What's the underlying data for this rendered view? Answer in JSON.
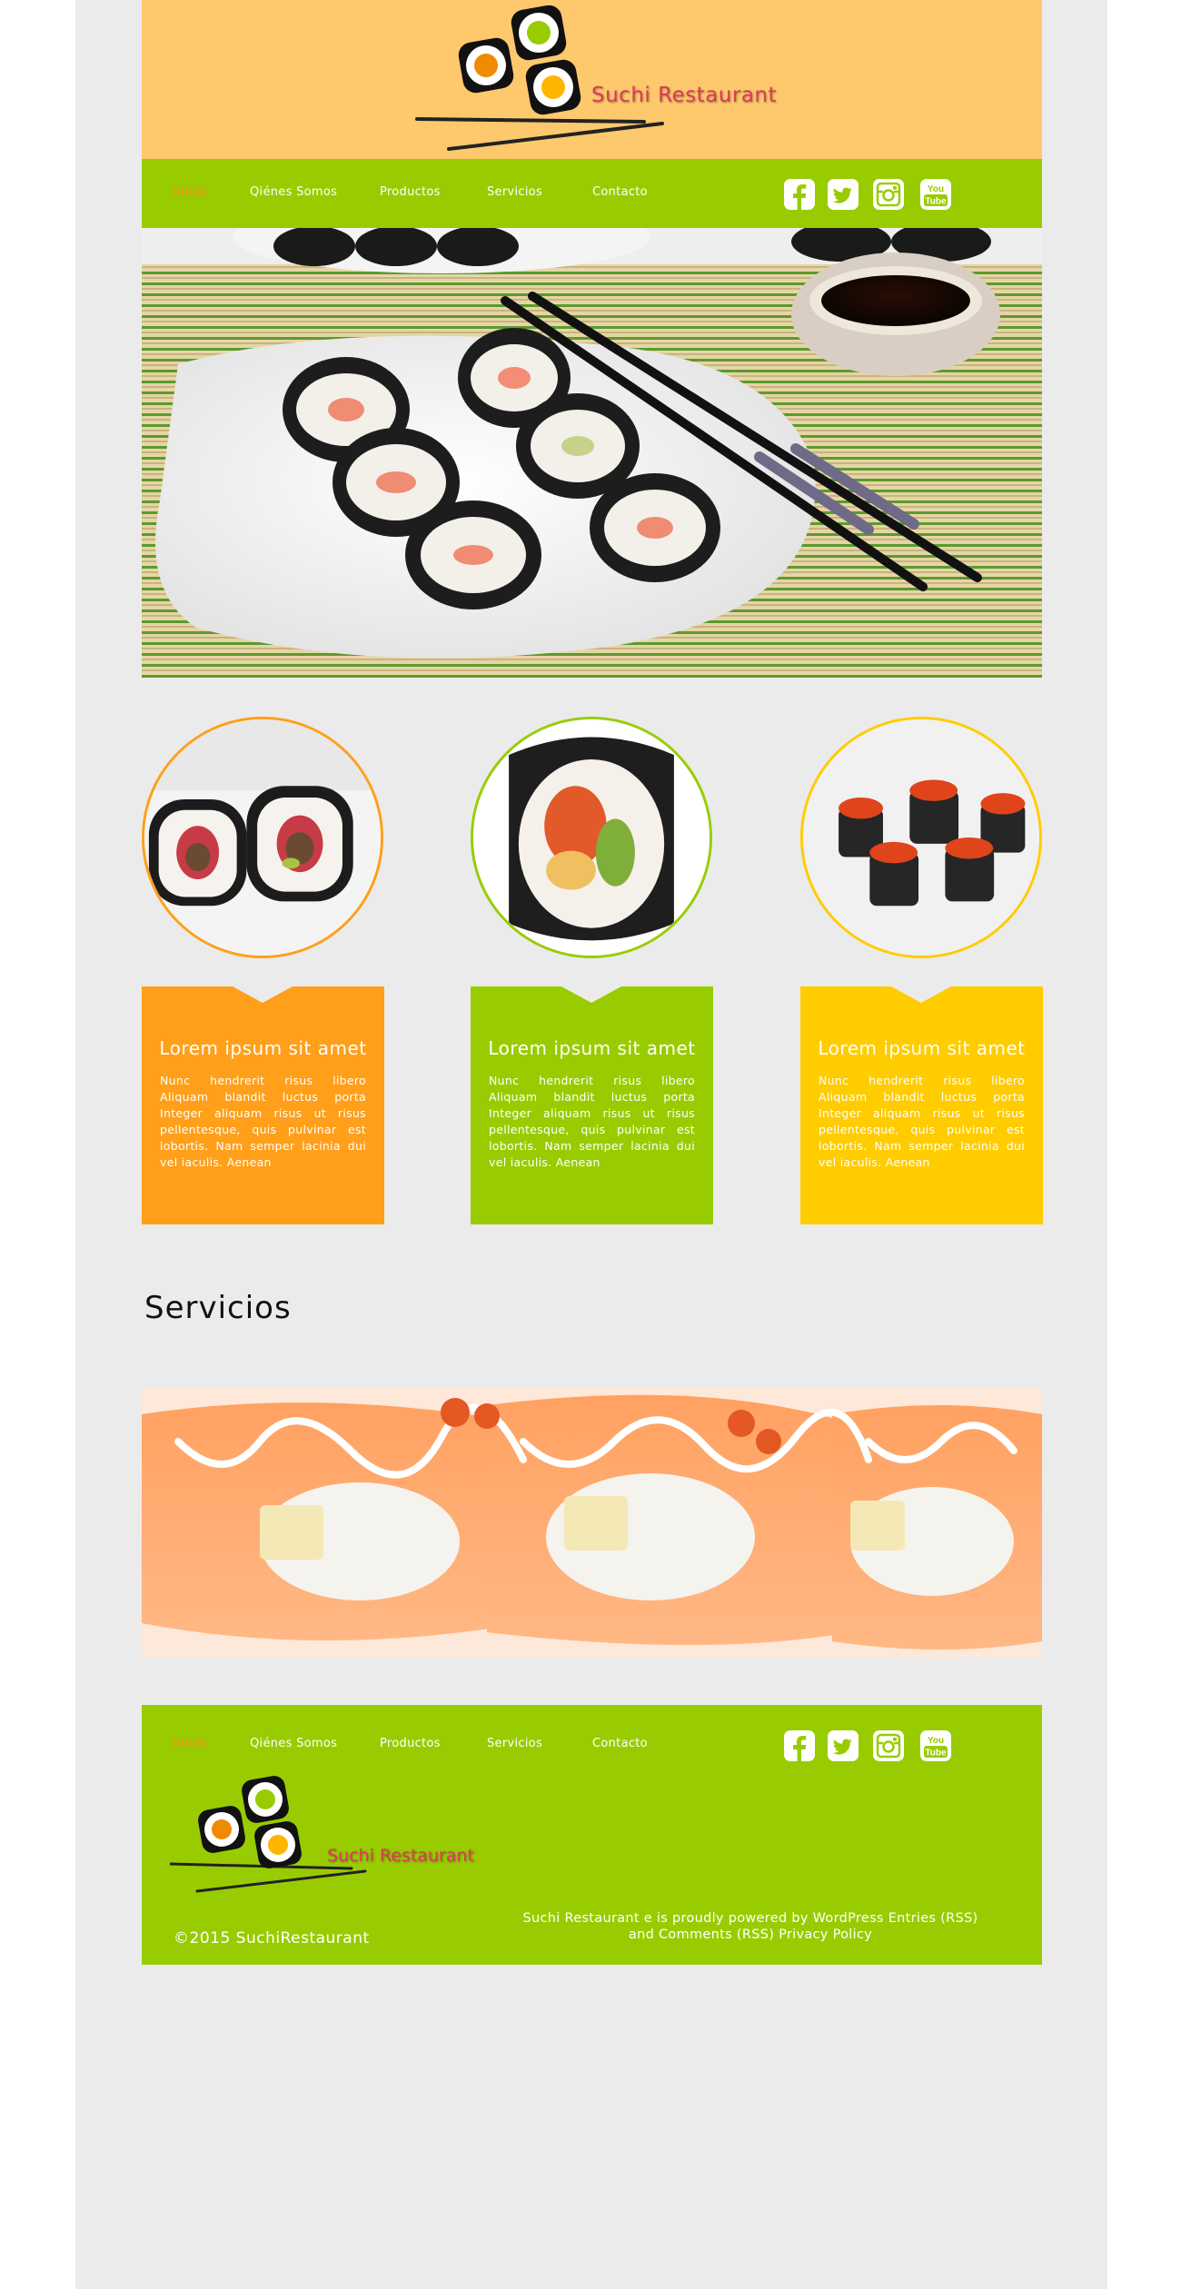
{
  "brand": {
    "name": "Suchi Restaurant"
  },
  "nav": {
    "items": [
      {
        "label": "Inicio",
        "active": true
      },
      {
        "label": "Qiénes Somos",
        "active": false
      },
      {
        "label": "Productos",
        "active": false
      },
      {
        "label": "Servicios",
        "active": false
      },
      {
        "label": "Contacto",
        "active": false
      }
    ],
    "social": [
      {
        "icon": "facebook-icon"
      },
      {
        "icon": "twitter-icon"
      },
      {
        "icon": "instagram-icon"
      },
      {
        "icon": "youtube-icon",
        "text_top": "You",
        "text_bottom": "Tube"
      }
    ]
  },
  "features": [
    {
      "title": "Lorem ipsum sit amet",
      "body": "Nunc hendrerit risus libero Aliquam blandit luctus porta Integer aliquam risus ut risus pellentesque, quis pulvinar est lobortis. Nam semper lacinia dui vel iaculis. Aenean",
      "color": "#ff9f1a",
      "ring_color": "#ff9f1a"
    },
    {
      "title": "Lorem ipsum sit amet",
      "body": "Nunc hendrerit risus libero Aliquam blandit luctus porta Integer aliquam risus ut risus pellentesque, quis pulvinar est lobortis. Nam semper lacinia dui vel iaculis. Aenean",
      "color": "#99cc00",
      "ring_color": "#99cc00"
    },
    {
      "title": "Lorem ipsum sit amet",
      "body": "Nunc hendrerit risus libero Aliquam blandit luctus porta Integer aliquam risus ut risus pellentesque, quis pulvinar est lobortis. Nam semper lacinia dui vel iaculis. Aenean",
      "color": "#ffcc00",
      "ring_color": "#ffcc00"
    }
  ],
  "servicios": {
    "title": "Servicios"
  },
  "footer": {
    "copyright": "©2015 SuchiRestaurant",
    "powered_line1": "Suchi Restaurant e is proudly powered by WordPress Entries (RSS)",
    "powered_line2": "and Comments (RSS) Privacy Policy"
  },
  "colors": {
    "header_bg": "#fdc96c",
    "nav_bg": "#99cc00",
    "active_link": "#ff8c1a",
    "brand_text": "#e0385a",
    "page_bg": "#ebebeb"
  }
}
